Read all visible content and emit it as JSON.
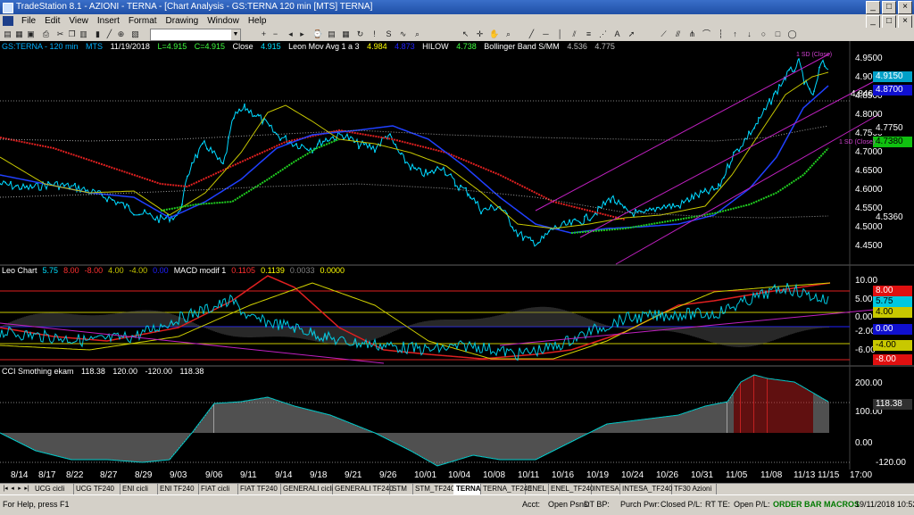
{
  "window": {
    "title": "TradeStation 8.1 - AZIONI - TERNA - [Chart Analysis - GS:TERNA  120 min  [MTS] TERNA]",
    "min": "_",
    "restore": "□",
    "close": "×"
  },
  "menu": [
    "File",
    "Edit",
    "View",
    "Insert",
    "Format",
    "Drawing",
    "Window",
    "Help"
  ],
  "price_pane": {
    "header": [
      "GS:TERNA - 120 min",
      "MTS",
      "11/19/2018",
      "L=4.915",
      "C=4.915",
      "Close",
      "4.915",
      "Leon Mov Avg 1 a 3",
      "4.984",
      "4.873",
      "HILOW",
      "4.738",
      "Bollinger Band S/MM",
      "4.536",
      "4.775"
    ],
    "y_ticks": [
      "4.9500",
      "4.9000",
      "4.8500",
      "4.8000",
      "4.7500",
      "4.7000",
      "4.6500",
      "4.6000",
      "4.5500",
      "4.5000",
      "4.4500"
    ],
    "tags": [
      {
        "label": "4.9150",
        "bg": "#00a0c8",
        "fg": "#ffffff"
      },
      {
        "label": "4.8700",
        "bg": "#1010d0",
        "fg": "#ffffff"
      },
      {
        "label": "4.7750",
        "bg": "#000000",
        "fg": "#ffffff"
      },
      {
        "label": "4.7380",
        "bg": "#10c010",
        "fg": "#000000"
      },
      {
        "label": "4.5360",
        "bg": "#000000",
        "fg": "#ffffff"
      }
    ],
    "annotation_846": "4.846",
    "sd_label_top": "1 SD (Close)",
    "sd_label_right": "1 SD (Close)"
  },
  "leo_pane": {
    "header": [
      "Leo Chart",
      "5.75",
      "8.00",
      "-8.00",
      "4.00",
      "-4.00",
      "0.00",
      "MACD modif 1",
      "0.1105",
      "0.1139",
      "0.0033",
      "0.0000"
    ],
    "header_colors": [
      "#ffffff",
      "#00e0ff",
      "#ff3030",
      "#ff3030",
      "#c8c800",
      "#c8c800",
      "#2020ff",
      "#ffffff",
      "#ff3030",
      "#ffff00",
      "#808080",
      "#ffff00"
    ],
    "y_ticks": [
      "10.00",
      "5.00",
      "0.00",
      "-2.00",
      "-6.00"
    ],
    "tags": [
      {
        "label": "8.00",
        "bg": "#e01010",
        "fg": "#ffffff"
      },
      {
        "label": "5.75",
        "bg": "#00c8e0",
        "fg": "#000000"
      },
      {
        "label": "4.00",
        "bg": "#c8c800",
        "fg": "#000000"
      },
      {
        "label": "0.00",
        "bg": "#1010d0",
        "fg": "#ffffff"
      },
      {
        "label": "-4.00",
        "bg": "#c8c800",
        "fg": "#000000"
      },
      {
        "label": "-8.00",
        "bg": "#e01010",
        "fg": "#ffffff"
      }
    ]
  },
  "cci_pane": {
    "header": [
      "CCI Smothing ekam",
      "118.38",
      "120.00",
      "-120.00",
      "118.38"
    ],
    "y_ticks": [
      "200.00",
      "100.00",
      "0.00"
    ],
    "tags": [
      {
        "label": "118.38",
        "bg": "#303030",
        "fg": "#ffffff"
      },
      {
        "label": "-120.00",
        "bg": "#000000",
        "fg": "#ffffff"
      }
    ]
  },
  "x_axis": [
    "8/14",
    "8/17",
    "8/22",
    "8/27",
    "8/29",
    "9/03",
    "9/06",
    "9/11",
    "9/14",
    "9/18",
    "9/21",
    "9/26",
    "10/01",
    "10/04",
    "10/08",
    "10/11",
    "10/16",
    "10/19",
    "10/24",
    "10/26",
    "10/31",
    "11/05",
    "11/08",
    "11/13",
    "11/15",
    "17:00"
  ],
  "tabs": [
    "UCG cicli",
    "UCG TF240",
    "ENI cicli",
    "ENI TF240",
    "FIAT cicli",
    "FIAT TF240",
    "GENERALI cicli",
    "GENERALI TF240",
    "STM",
    "STM_TF240",
    "TERNA",
    "TERNA_TF240",
    "ENEL",
    "ENEL_TF240",
    "INTESA",
    "INTESA_TF240",
    "TF30 Azioni"
  ],
  "active_tab": "TERNA",
  "status": {
    "help": "For Help, press F1",
    "acct": "Acct:",
    "open_psns": "Open Psns:",
    "dt_bp": "DT BP:",
    "purch_pwr": "Purch Pwr:",
    "closed_pl": "Closed P/L:",
    "rt_te": "RT TE:",
    "open_pl": "Open P/L:",
    "order_bar": "ORDER BAR  MACROS",
    "datetime": "19/11/2018 10:52"
  }
}
